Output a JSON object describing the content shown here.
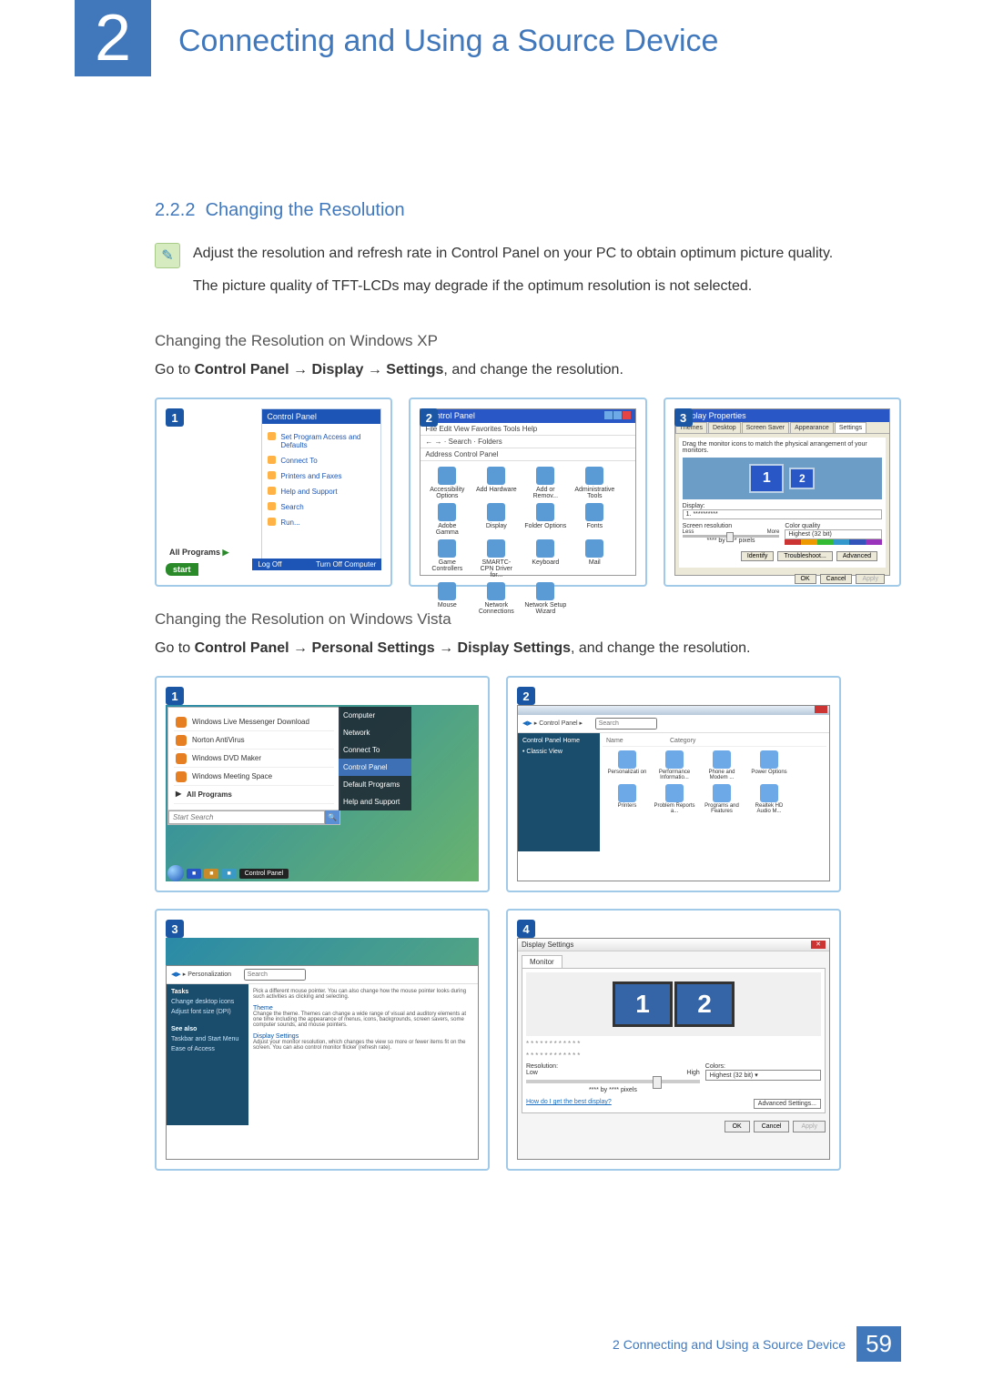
{
  "chapter": {
    "number": "2",
    "title": "Connecting and Using a Source Device"
  },
  "section": {
    "number": "2.2.2",
    "title": "Changing the Resolution"
  },
  "note": {
    "line1": "Adjust the resolution and refresh rate in Control Panel on your PC to obtain optimum picture quality.",
    "line2": "The picture quality of TFT-LCDs may degrade if the optimum resolution is not selected."
  },
  "xp": {
    "subhead": "Changing the Resolution on Windows XP",
    "instruction_prefix": "Go to ",
    "path_parts": [
      "Control Panel",
      "Display",
      "Settings"
    ],
    "arrow": " → ",
    "instruction_suffix": ", and change the resolution.",
    "start": {
      "header": "Control Panel",
      "items": [
        "Set Program Access and Defaults",
        "Connect To",
        "Printers and Faxes",
        "Help and Support",
        "Search",
        "Run..."
      ],
      "all_programs": "All Programs",
      "log_off": "Log Off",
      "turn_off": "Turn Off Computer",
      "start": "start"
    },
    "cp": {
      "title": "Control Panel",
      "menu": "File  Edit  View  Favorites  Tools  Help",
      "toolbar": "← → · Search · Folders",
      "address": "Address  Control Panel",
      "icons": [
        "Accessibility Options",
        "Add Hardware",
        "Add or Remov...",
        "Administrative Tools",
        "Adobe Gamma",
        "Display",
        "Folder Options",
        "Fonts",
        "Game Controllers",
        "SMARTC-CPN Driver for...",
        "Keyboard",
        "Mail",
        "Mouse",
        "Network Connections",
        "Network Setup Wizard"
      ]
    },
    "dp": {
      "title": "Display Properties",
      "tabs": [
        "Themes",
        "Desktop",
        "Screen Saver",
        "Appearance",
        "Settings"
      ],
      "active_tab": "Settings",
      "drag_text": "Drag the monitor icons to match the physical arrangement of your monitors.",
      "mon1": "1",
      "mon2": "2",
      "display_label": "Display:",
      "display_value": "1. **********",
      "res_label": "Screen resolution",
      "res_less": "Less",
      "res_more": "More",
      "res_value": "**** by **** pixels",
      "col_label": "Color quality",
      "col_value": "Highest (32 bit)",
      "buttons_row": [
        "Identify",
        "Troubleshoot...",
        "Advanced"
      ],
      "buttons_footer": [
        "OK",
        "Cancel",
        "Apply"
      ]
    }
  },
  "vista": {
    "subhead": "Changing the Resolution on Windows Vista",
    "instruction_prefix": "Go to ",
    "path_parts": [
      "Control Panel",
      "Personal Settings",
      "Display Settings"
    ],
    "arrow": " → ",
    "instruction_suffix": ", and change the resolution.",
    "start": {
      "items": [
        "Windows Live Messenger Download",
        "Norton AntiVirus",
        "Windows DVD Maker",
        "Windows Meeting Space"
      ],
      "all_programs": "All Programs",
      "search_placeholder": "Start Search",
      "right": [
        "Computer",
        "Network",
        "Connect To",
        "Control Panel",
        "Default Programs",
        "Help and Support"
      ],
      "highlight": "Control Panel",
      "task_label": "Control Panel"
    },
    "cp": {
      "nav": "▸ Control Panel ▸",
      "search_placeholder": "Search",
      "side_title": "Control Panel Home",
      "side_link": "Classic View",
      "cols": [
        "Name",
        "Category"
      ],
      "icons": [
        "Personalizati on",
        "Performance Informatio...",
        "Phone and Modem ...",
        "Power Options",
        "Printers",
        "Problem Reports a...",
        "Programs and Features",
        "Realtek HD Audio M..."
      ]
    },
    "per": {
      "nav": "▸ Personalization",
      "search_placeholder": "Search",
      "side_tasks_title": "Tasks",
      "side_tasks": [
        "Change desktop icons",
        "Adjust font size (DPI)"
      ],
      "side_seealso_title": "See also",
      "side_seealso": [
        "Taskbar and Start Menu",
        "Ease of Access"
      ],
      "items": [
        {
          "h": "",
          "d": "Pick a different mouse pointer. You can also change how the mouse pointer looks during such activities as clicking and selecting."
        },
        {
          "h": "Theme",
          "d": "Change the theme. Themes can change a wide range of visual and auditory elements at one time including the appearance of menus, icons, backgrounds, screen savers, some computer sounds, and mouse pointers."
        },
        {
          "h": "Display Settings",
          "d": "Adjust your monitor resolution, which changes the view so more or fewer items fit on the screen. You can also control monitor flicker (refresh rate)."
        }
      ]
    },
    "ds": {
      "title": "Display Settings",
      "tab": "Monitor",
      "mon1": "1",
      "mon2": "2",
      "dots1": "************",
      "dots2": "************",
      "res_label": "Resolution:",
      "res_low": "Low",
      "res_high": "High",
      "res_value": "**** by **** pixels",
      "col_label": "Colors:",
      "col_value": "Highest (32 bit)",
      "link": "How do I get the best display?",
      "adv": "Advanced Settings...",
      "buttons": [
        "OK",
        "Cancel",
        "Apply"
      ]
    }
  },
  "badges": {
    "b1": "1",
    "b2": "2",
    "b3": "3",
    "b4": "4"
  },
  "footer": {
    "text": "2 Connecting and Using a Source Device",
    "page": "59"
  }
}
